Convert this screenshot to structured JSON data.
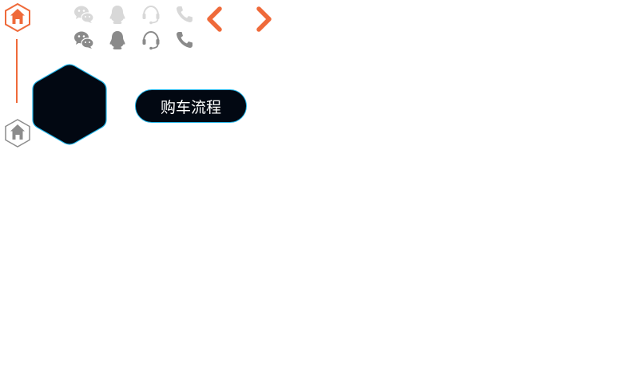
{
  "nav": {
    "home_active_icon": "home-hex-icon",
    "home_inactive_icon": "home-hex-icon",
    "colors": {
      "accent": "#ef6a3a",
      "inactive": "#8c8c8c",
      "icon_light": "#d8d8d8",
      "icon_dark": "#8a8a8a"
    }
  },
  "contact_icons": {
    "row_light": [
      "wechat-icon",
      "qq-icon",
      "customer-service-icon",
      "phone-icon"
    ],
    "row_dark": [
      "wechat-icon",
      "qq-icon",
      "customer-service-icon",
      "phone-icon"
    ]
  },
  "arrows": {
    "prev_icon": "chevron-left-icon",
    "next_icon": "chevron-right-icon",
    "color": "#ef6a3a"
  },
  "hexagon": {
    "fill": "#020812",
    "border": "#1fb2e6"
  },
  "process_button": {
    "label": "购车流程"
  }
}
